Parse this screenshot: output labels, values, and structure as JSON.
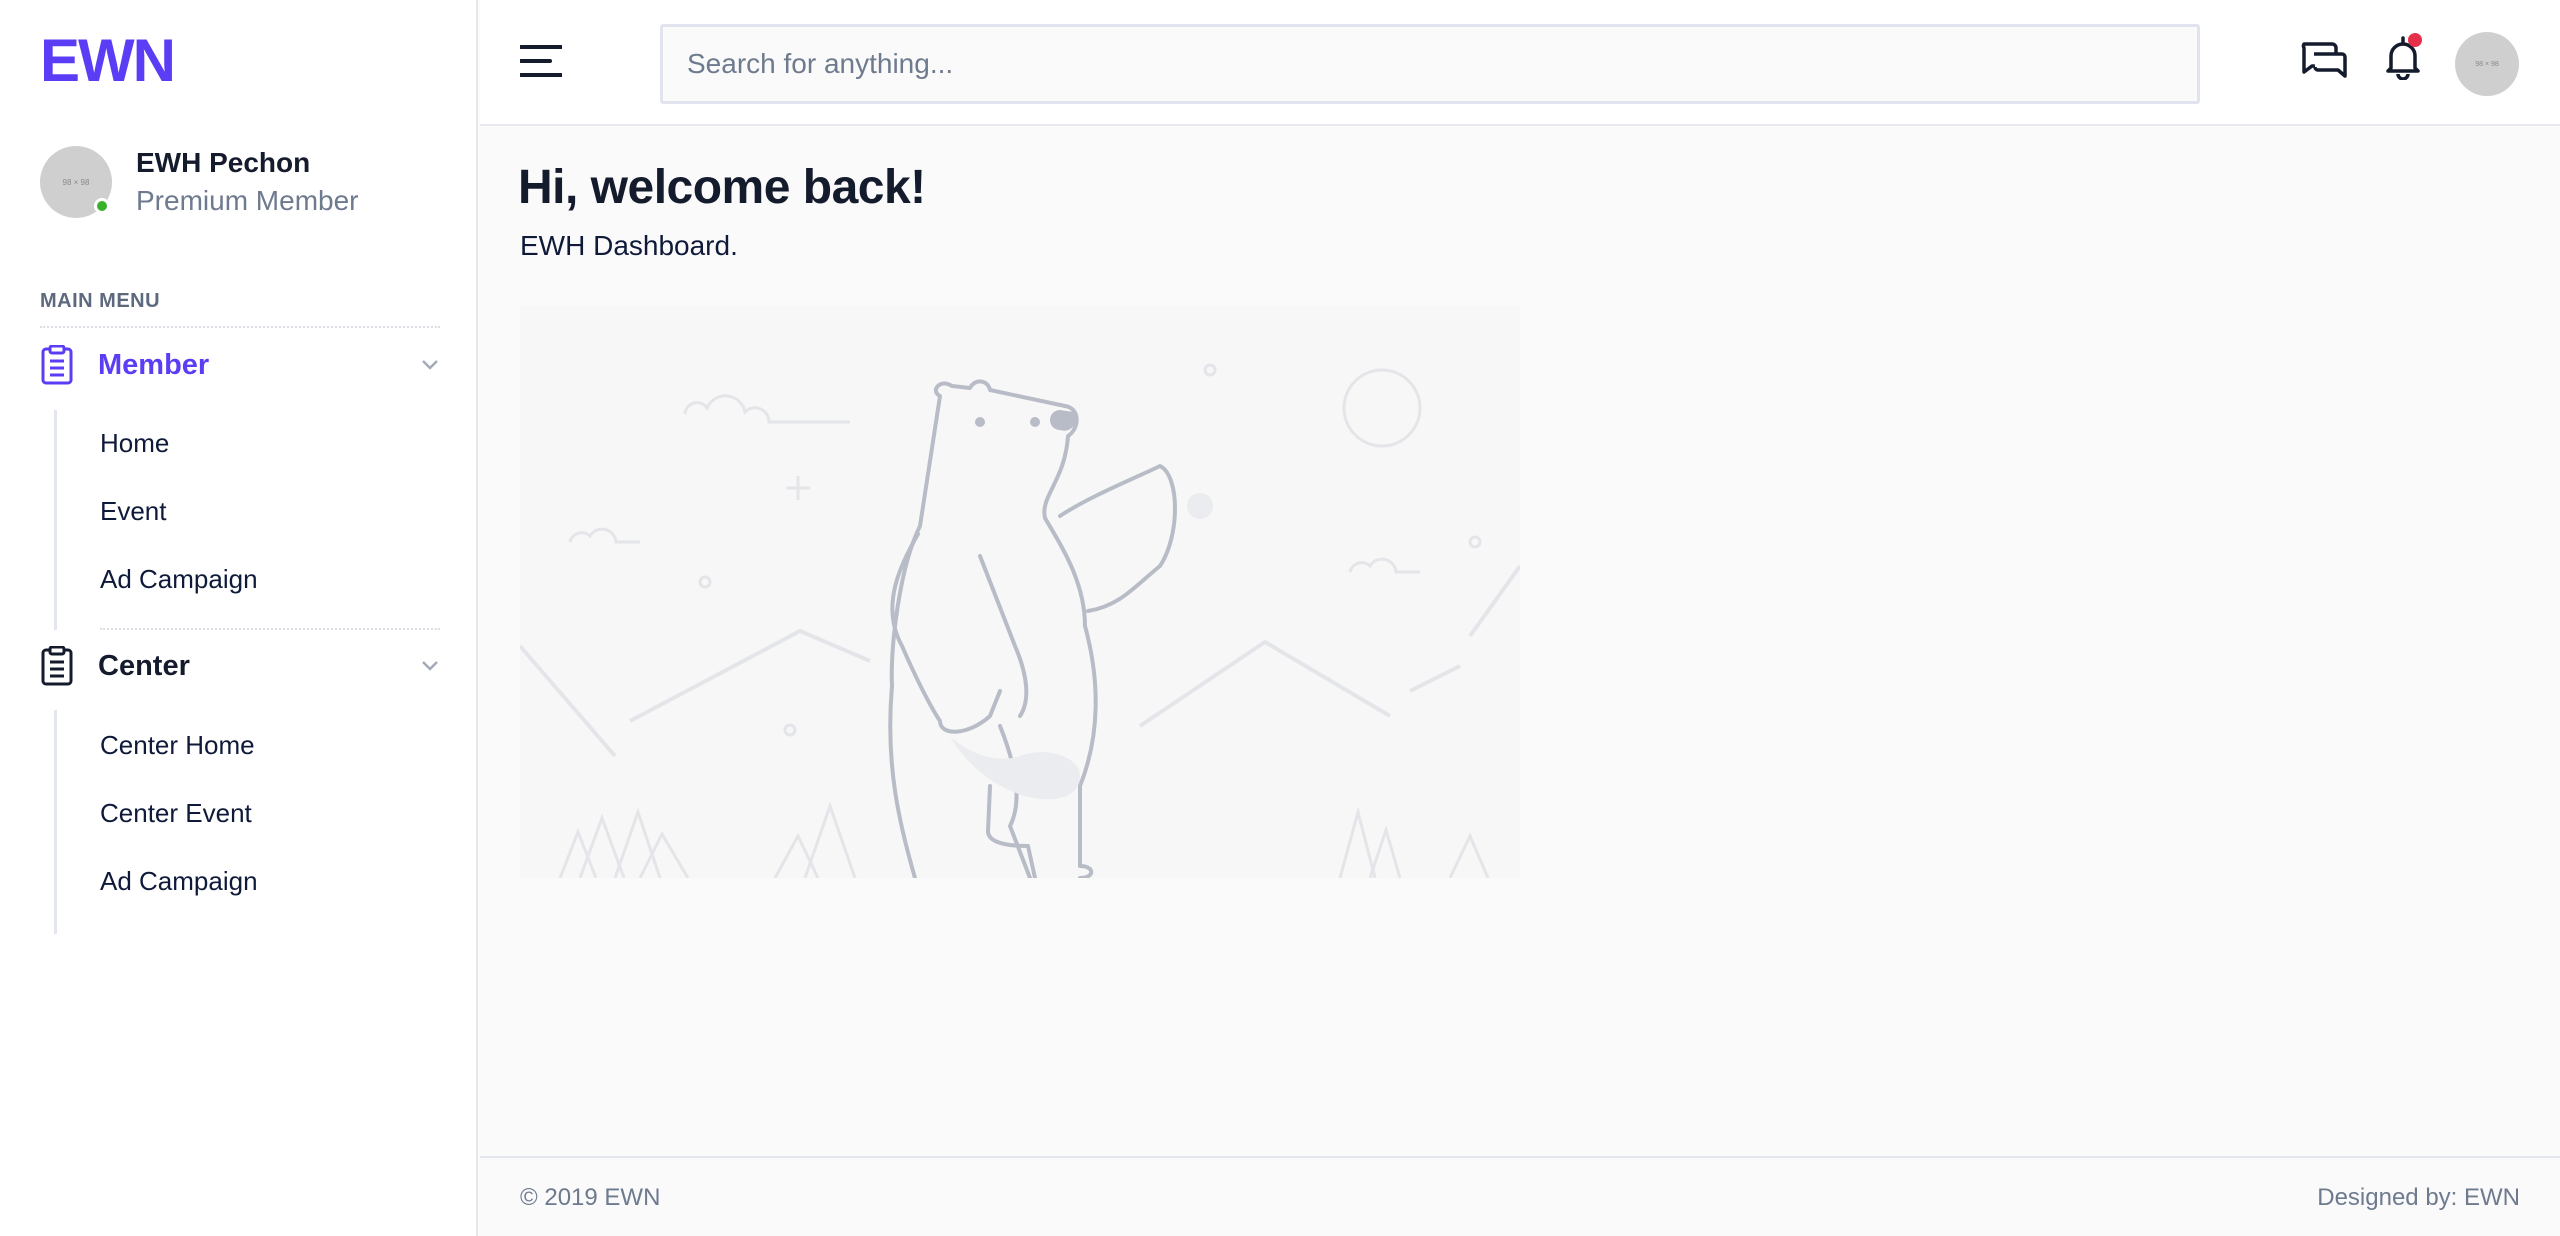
{
  "brand": {
    "name": "EWN",
    "color": "#5b3df5"
  },
  "user": {
    "name": "EWH Pechon",
    "role": "Premium Member",
    "status_color": "#37b22a",
    "avatar_text": "98 × 98"
  },
  "sidebar": {
    "menu_heading": "MAIN MENU",
    "groups": [
      {
        "label": "Member",
        "icon": "clipboard-icon",
        "active": true,
        "items": [
          {
            "label": "Home"
          },
          {
            "label": "Event"
          },
          {
            "label": "Ad Campaign"
          }
        ]
      },
      {
        "label": "Center",
        "icon": "clipboard-icon",
        "active": false,
        "items": [
          {
            "label": "Center Home"
          },
          {
            "label": "Center Event"
          },
          {
            "label": "Ad Campaign"
          }
        ]
      }
    ]
  },
  "header": {
    "search_placeholder": "Search for anything...",
    "icons": [
      "menu-icon",
      "chat-icon",
      "bell-icon"
    ],
    "notification_dot_color": "#e6304b",
    "avatar_text": "98 × 98"
  },
  "main": {
    "greeting": "Hi, welcome back!",
    "subtitle": "EWH Dashboard.",
    "illustration": "bear-waving-illustration"
  },
  "footer": {
    "copyright": "© 2019 EWN",
    "designed_by": "Designed by: EWN"
  }
}
